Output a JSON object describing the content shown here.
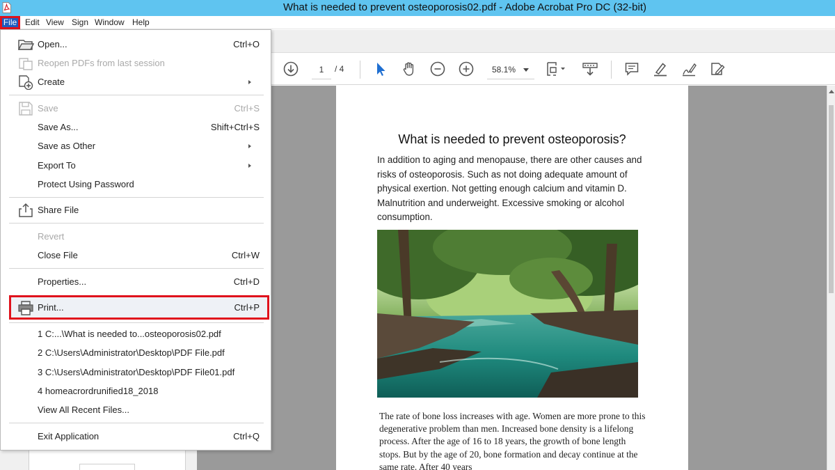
{
  "window": {
    "title": "What is needed to prevent osteoporosis02.pdf - Adobe Acrobat Pro DC (32-bit)",
    "app_icon": "acrobat-pdf-icon",
    "accent_color": "#5fc4f0",
    "highlight_color": "#e0121c"
  },
  "menubar": {
    "items": [
      "File",
      "Edit",
      "View",
      "Sign",
      "Window",
      "Help"
    ]
  },
  "toolbar": {
    "page_current": "1",
    "page_total": "/ 4",
    "zoom": "58.1%",
    "icons": [
      "download-icon",
      "select-cursor-icon",
      "hand-tool-icon",
      "zoom-out-icon",
      "zoom-in-icon",
      "fit-page-icon",
      "scroll-mode-icon",
      "comment-icon",
      "highlight-pen-icon",
      "sign-icon",
      "edit-pdf-icon"
    ]
  },
  "file_menu": {
    "items": [
      {
        "label": "Open...",
        "shortcut": "Ctrl+O",
        "icon": "open-folder-icon"
      },
      {
        "label": "Reopen PDFs from last session",
        "shortcut": "",
        "icon": "reopen-icon",
        "disabled": true
      },
      {
        "label": "Create",
        "shortcut": "",
        "icon": "create-icon",
        "submenu": true
      },
      {
        "label": "Save",
        "shortcut": "Ctrl+S",
        "icon": "save-icon",
        "disabled": true
      },
      {
        "label": "Save As...",
        "shortcut": "Shift+Ctrl+S"
      },
      {
        "label": "Save as Other",
        "shortcut": "",
        "submenu": true
      },
      {
        "label": "Export To",
        "shortcut": "",
        "submenu": true
      },
      {
        "label": "Protect Using Password",
        "shortcut": ""
      },
      {
        "label": "Share File",
        "shortcut": "",
        "icon": "share-icon"
      },
      {
        "label": "Revert",
        "shortcut": "",
        "disabled": true
      },
      {
        "label": "Close File",
        "shortcut": "Ctrl+W"
      },
      {
        "label": "Properties...",
        "shortcut": "Ctrl+D"
      },
      {
        "label": "Print...",
        "shortcut": "Ctrl+P",
        "icon": "printer-icon",
        "highlighted": true
      },
      {
        "label": "1 C:...\\What is needed to...osteoporosis02.pdf",
        "shortcut": ""
      },
      {
        "label": "2 C:\\Users\\Administrator\\Desktop\\PDF File.pdf",
        "shortcut": ""
      },
      {
        "label": "3 C:\\Users\\Administrator\\Desktop\\PDF File01.pdf",
        "shortcut": ""
      },
      {
        "label": "4 homeacrordrunified18_2018",
        "shortcut": ""
      },
      {
        "label": "View All Recent Files...",
        "shortcut": ""
      },
      {
        "label": "Exit Application",
        "shortcut": "Ctrl+Q"
      }
    ]
  },
  "document": {
    "title": "What is needed to prevent osteoporosis?",
    "paragraph1": "In addition to aging and menopause, there are other causes and risks of osteoporosis. Such as not doing adequate amount of physical exertion. Not getting enough calcium and vitamin D. Malnutrition and underweight. Excessive smoking or alcohol consumption.",
    "image": "forest-river-photo",
    "paragraph2": "The rate of bone loss increases with age. Women are more prone to this degenerative problem than men. Increased bone density is a lifelong process. After the age of 16 to 18 years, the growth of bone length stops. But by the age of 20, bone formation and decay continue at the same rate. After 40 years"
  }
}
